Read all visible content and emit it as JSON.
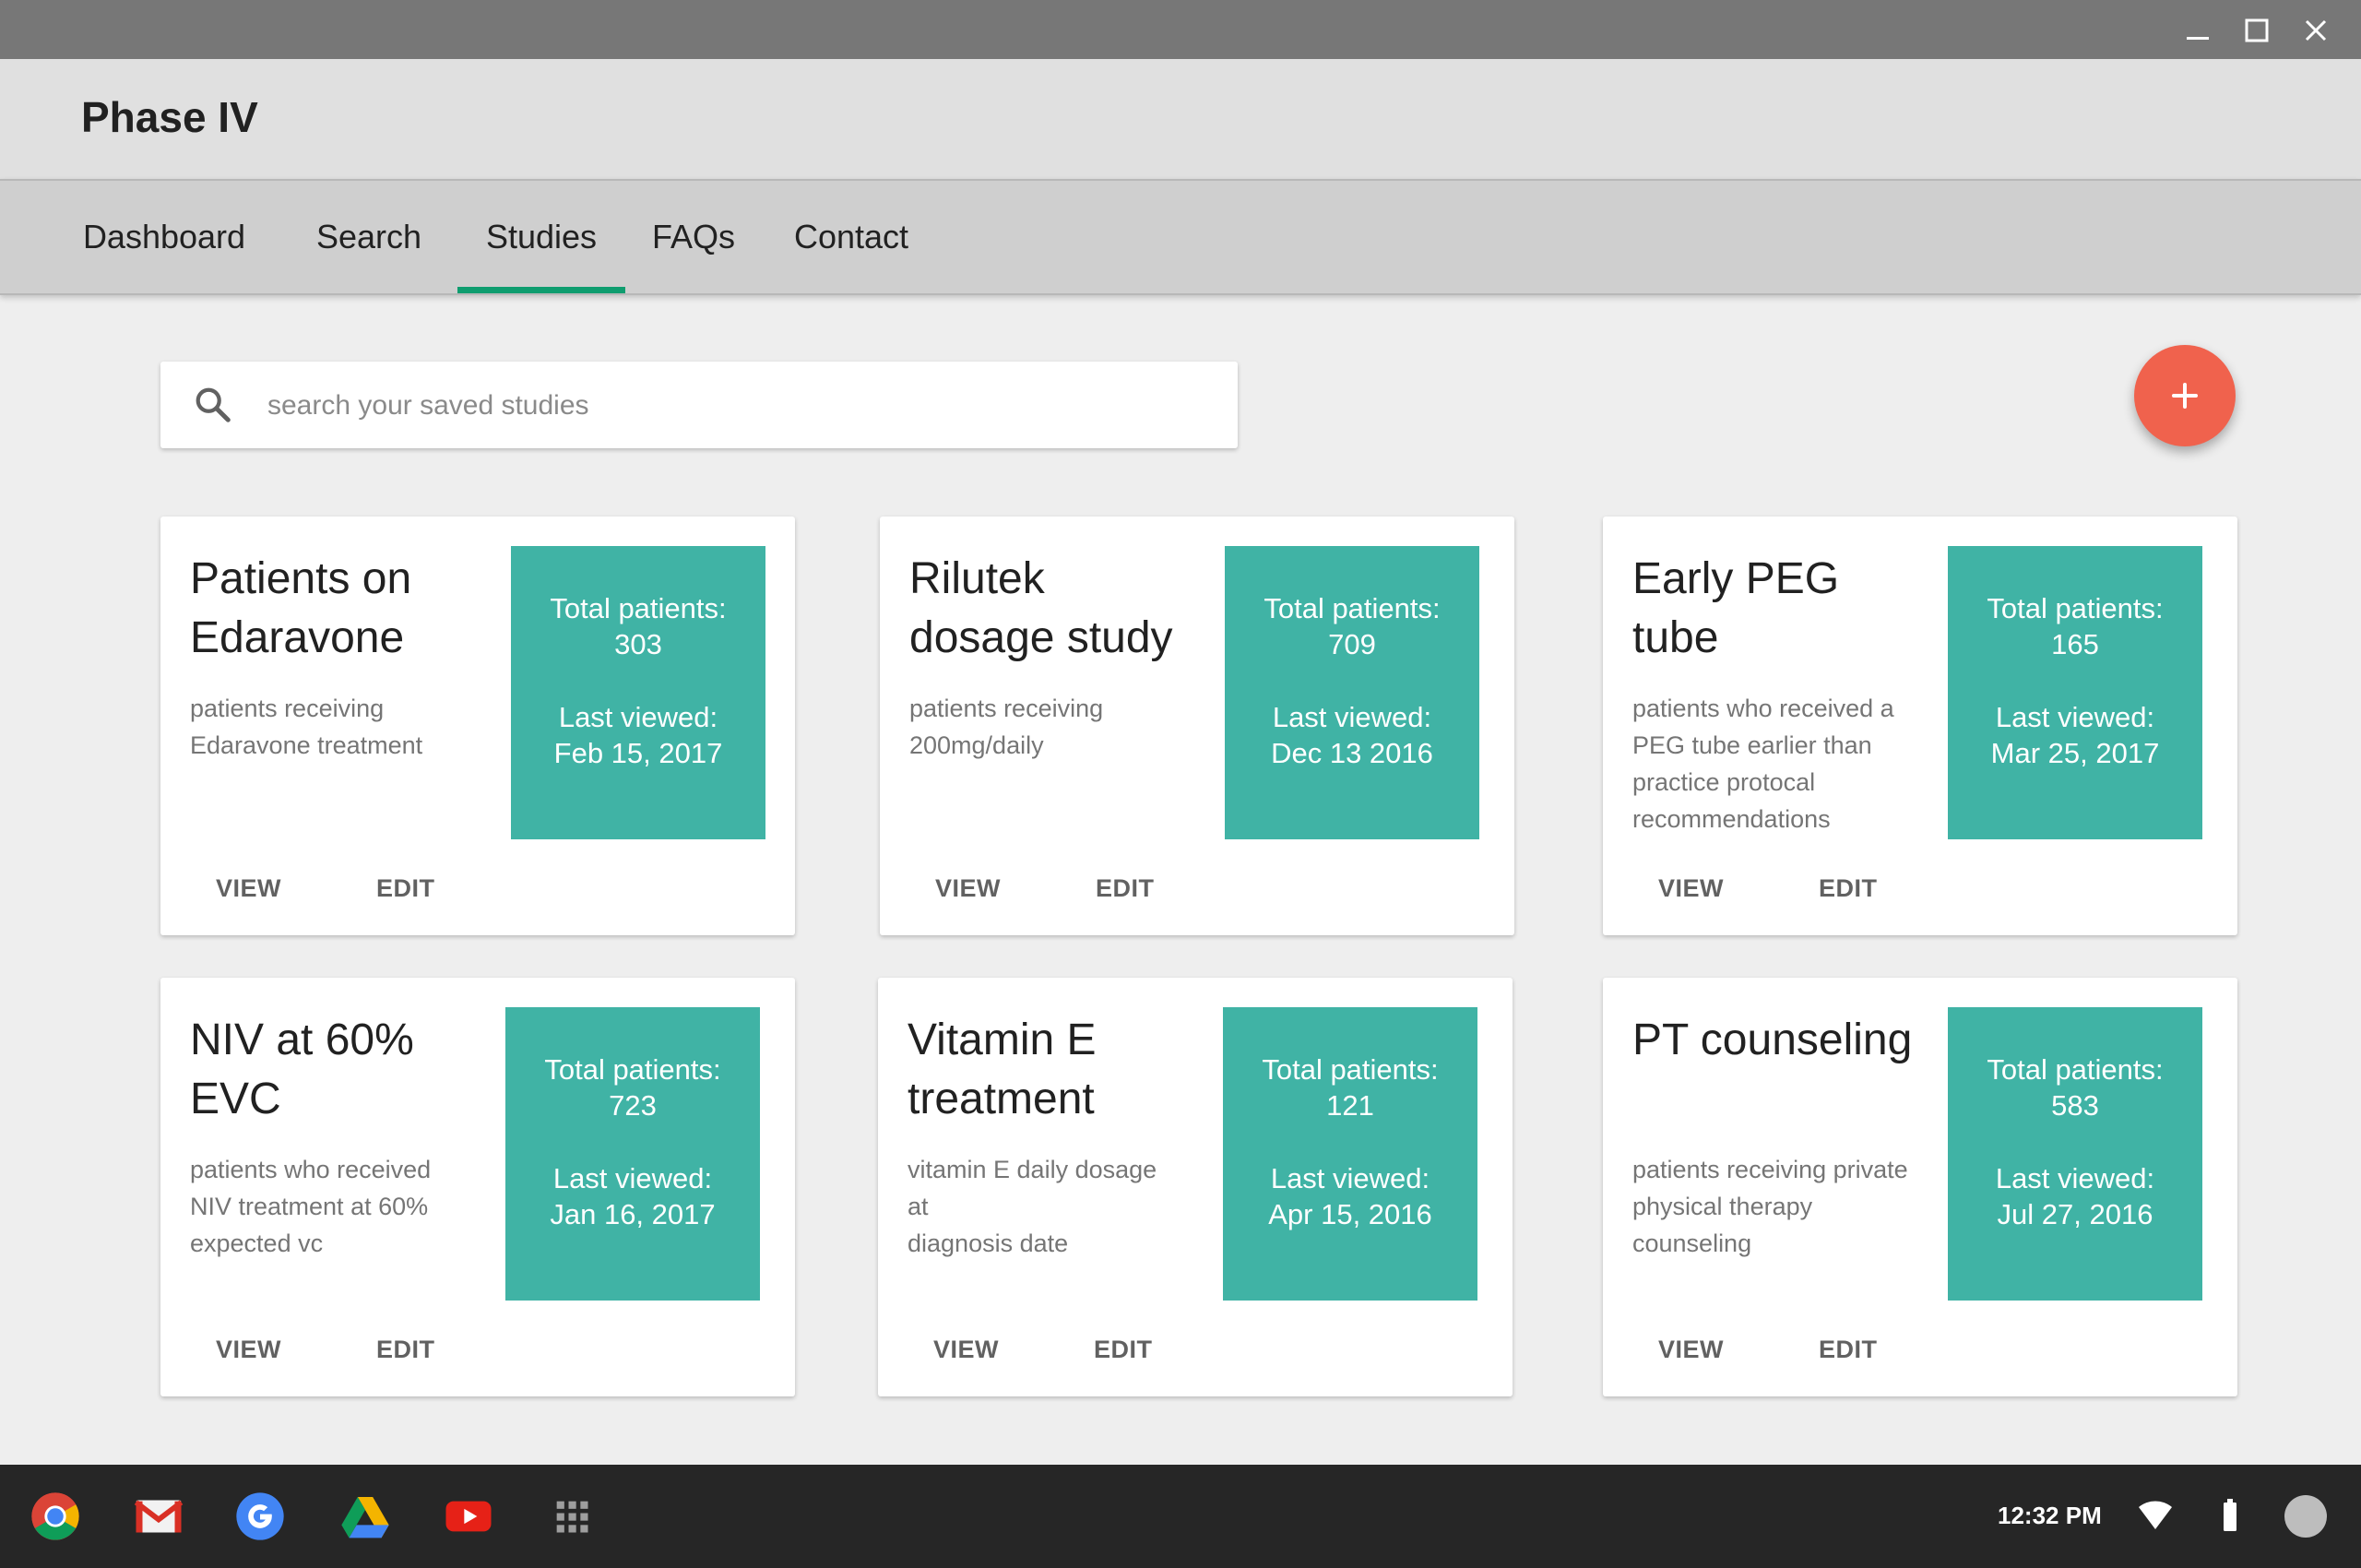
{
  "window": {
    "controls": [
      "minimize-icon",
      "maximize-icon",
      "close-icon"
    ]
  },
  "app": {
    "title": "Phase IV"
  },
  "nav": {
    "tabs": [
      {
        "label": "Dashboard",
        "active": false
      },
      {
        "label": "Search",
        "active": false
      },
      {
        "label": "Studies",
        "active": true
      },
      {
        "label": "FAQs",
        "active": false
      },
      {
        "label": "Contact",
        "active": false
      }
    ]
  },
  "search": {
    "placeholder": "search your saved studies",
    "value": ""
  },
  "fab": {
    "label": "+",
    "icon": "add-icon"
  },
  "colors": {
    "accent": "#0f9d6f",
    "stats_bg": "#40b3a5",
    "fab": "#f0624d"
  },
  "cards": [
    {
      "title_line1": "Patients on",
      "title_line2": "Edaravone",
      "desc_line1": "patients receiving",
      "desc_line2": "Edaravone treatment",
      "desc_line3": "",
      "desc_line4": "",
      "total_label": "Total patients:",
      "total": "303",
      "viewed_label": "Last viewed:",
      "viewed": "Feb 15, 2017",
      "view": "VIEW",
      "edit": "EDIT"
    },
    {
      "title_line1": "Rilutek",
      "title_line2": "dosage study",
      "desc_line1": "patients receiving",
      "desc_line2": "200mg/daily",
      "desc_line3": "",
      "desc_line4": "",
      "total_label": "Total patients:",
      "total": "709",
      "viewed_label": "Last viewed:",
      "viewed": "Dec 13 2016",
      "view": "VIEW",
      "edit": "EDIT"
    },
    {
      "title_line1": "Early PEG",
      "title_line2": "tube",
      "desc_line1": "patients who received a",
      "desc_line2": "PEG tube earlier than",
      "desc_line3": "practice protocal",
      "desc_line4": "recommendations",
      "total_label": "Total patients:",
      "total": "165",
      "viewed_label": "Last viewed:",
      "viewed": "Mar 25, 2017",
      "view": "VIEW",
      "edit": "EDIT"
    },
    {
      "title_line1": "NIV at 60%",
      "title_line2": "EVC",
      "desc_line1": "patients who received",
      "desc_line2": "NIV treatment at 60%",
      "desc_line3": "expected vc",
      "desc_line4": "",
      "total_label": "Total patients:",
      "total": "723",
      "viewed_label": "Last viewed:",
      "viewed": "Jan 16, 2017",
      "view": "VIEW",
      "edit": "EDIT"
    },
    {
      "title_line1": "Vitamin E",
      "title_line2": "treatment",
      "desc_line1": "vitamin E daily dosage at",
      "desc_line2": "diagnosis date",
      "desc_line3": "",
      "desc_line4": "",
      "total_label": "Total patients:",
      "total": "121",
      "viewed_label": "Last viewed:",
      "viewed": "Apr 15, 2016",
      "view": "VIEW",
      "edit": "EDIT"
    },
    {
      "title_line1": "PT counseling",
      "title_line2": "",
      "desc_line1": "patients receiving private",
      "desc_line2": "physical therapy",
      "desc_line3": "counseling",
      "desc_line4": "",
      "total_label": "Total patients:",
      "total": "583",
      "viewed_label": "Last viewed:",
      "viewed": "Jul 27, 2016",
      "view": "VIEW",
      "edit": "EDIT"
    }
  ],
  "shelf": {
    "apps": [
      "chrome-icon",
      "gmail-icon",
      "google-icon",
      "drive-icon",
      "youtube-icon",
      "app-launcher-icon"
    ],
    "time": "12:32 PM",
    "status": [
      "wifi-icon",
      "battery-icon",
      "account-avatar"
    ]
  }
}
